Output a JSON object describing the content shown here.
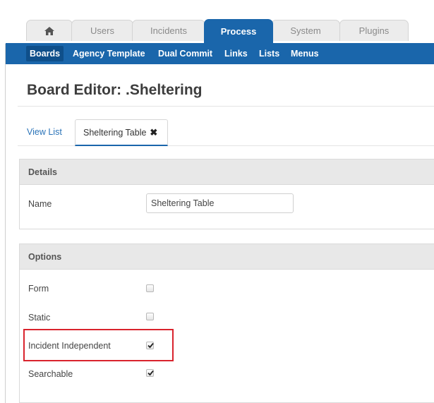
{
  "top_tabs": {
    "home_icon": "home-icon",
    "items": [
      {
        "label": "Users"
      },
      {
        "label": "Incidents"
      },
      {
        "label": "Process"
      },
      {
        "label": "System"
      },
      {
        "label": "Plugins"
      }
    ],
    "active": "Process"
  },
  "subnav": {
    "items": [
      {
        "label": "Boards"
      },
      {
        "label": "Agency Template"
      },
      {
        "label": "Dual Commit"
      },
      {
        "label": "Links"
      },
      {
        "label": "Lists"
      },
      {
        "label": "Menus"
      }
    ],
    "active": "Boards"
  },
  "page": {
    "title": "Board Editor: .Sheltering"
  },
  "subtabs": {
    "view_list": "View List",
    "active_tab": "Sheltering Table",
    "close_glyph": "✖"
  },
  "details": {
    "heading": "Details",
    "name_label": "Name",
    "name_value": "Sheltering Table"
  },
  "options": {
    "heading": "Options",
    "items": [
      {
        "label": "Form",
        "checked": false
      },
      {
        "label": "Static",
        "checked": false
      },
      {
        "label": "Incident Independent",
        "checked": true
      },
      {
        "label": "Searchable",
        "checked": true
      }
    ]
  },
  "colors": {
    "primary": "#1a66ab",
    "highlight": "#d9232d"
  }
}
